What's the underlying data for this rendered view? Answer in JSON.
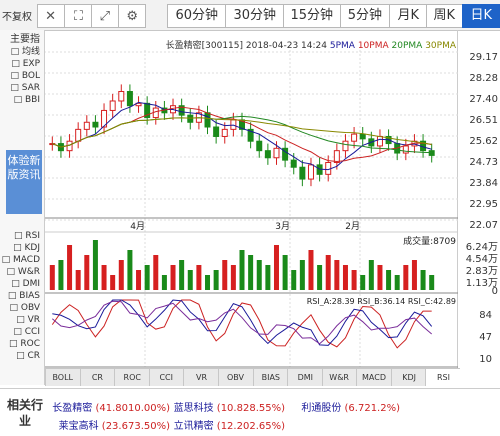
{
  "tabs": [
    "日K",
    "周K",
    "月K",
    "5分钟",
    "15分钟",
    "30分钟",
    "60分钟"
  ],
  "active_tab": 0,
  "tools": {
    "settings": "⚙",
    "expand": "⤢",
    "fullscreen": "⛶",
    "close": "✕"
  },
  "side_menu": {
    "title": "主要指",
    "items": [
      "均线",
      "EXP",
      "BOL",
      "SAR",
      "BBI"
    ],
    "tab": "不复权"
  },
  "header": {
    "text": "长盈精密[300115] 2018-04-23 14:24",
    "ma5": "5PMA",
    "ma10": "10PMA",
    "ma20": "20PMA",
    "ma30": "30PMA",
    "colors": {
      "ma5": "#1a1a99",
      "ma10": "#cc2222",
      "ma20": "#228822",
      "ma30": "#888800"
    }
  },
  "price_axis": [
    "29.17",
    "28.28",
    "27.40",
    "26.51",
    "25.62",
    "24.73",
    "23.84",
    "22.95",
    "22.07"
  ],
  "month_labels": [
    "2月",
    "3月",
    "4月"
  ],
  "volume": {
    "label": "成交量:8709",
    "axis": [
      "6.24万",
      "4.54万",
      "2.83万",
      "1.13万",
      "0"
    ]
  },
  "rsi": {
    "label": "RSI_A:28.39 RSI_B:36.14 RSI_C:42.89",
    "axis": [
      "84",
      "47",
      "10"
    ],
    "colors": {
      "a": "#cc2222",
      "b": "#1a1a99",
      "c": "#7a2d9a"
    }
  },
  "indicator_panel": {
    "items": [
      "RSI",
      "KDJ",
      "MACD",
      "W&R",
      "DMI",
      "BIAS",
      "OBV",
      "VR",
      "CCI",
      "ROC",
      "CR"
    ]
  },
  "subtabs": [
    "RSI",
    "KDJ",
    "MACD",
    "W&R",
    "DMI",
    "BIAS",
    "OBV",
    "VR",
    "CCI",
    "ROC",
    "CR",
    "BOLL"
  ],
  "ad": {
    "text": "体验新版资讯"
  },
  "bottom": {
    "title": "相关行业",
    "row1": [
      {
        "name": "长盈精密",
        "val": "(41.80",
        "pct": "10.00%)"
      },
      {
        "name": "蓝思科技",
        "val": "(10.82",
        "pct": "8.55%)"
      },
      {
        "name": "利通股份",
        "val": "(6.72",
        "pct": "1.2%)"
      }
    ],
    "row2": [
      {
        "name": "莱宝高科",
        "val": "(23.67",
        "pct": "3.50%)"
      },
      {
        "name": "立讯精密",
        "val": "(12.20",
        "pct": "2.65%)"
      }
    ]
  }
}
